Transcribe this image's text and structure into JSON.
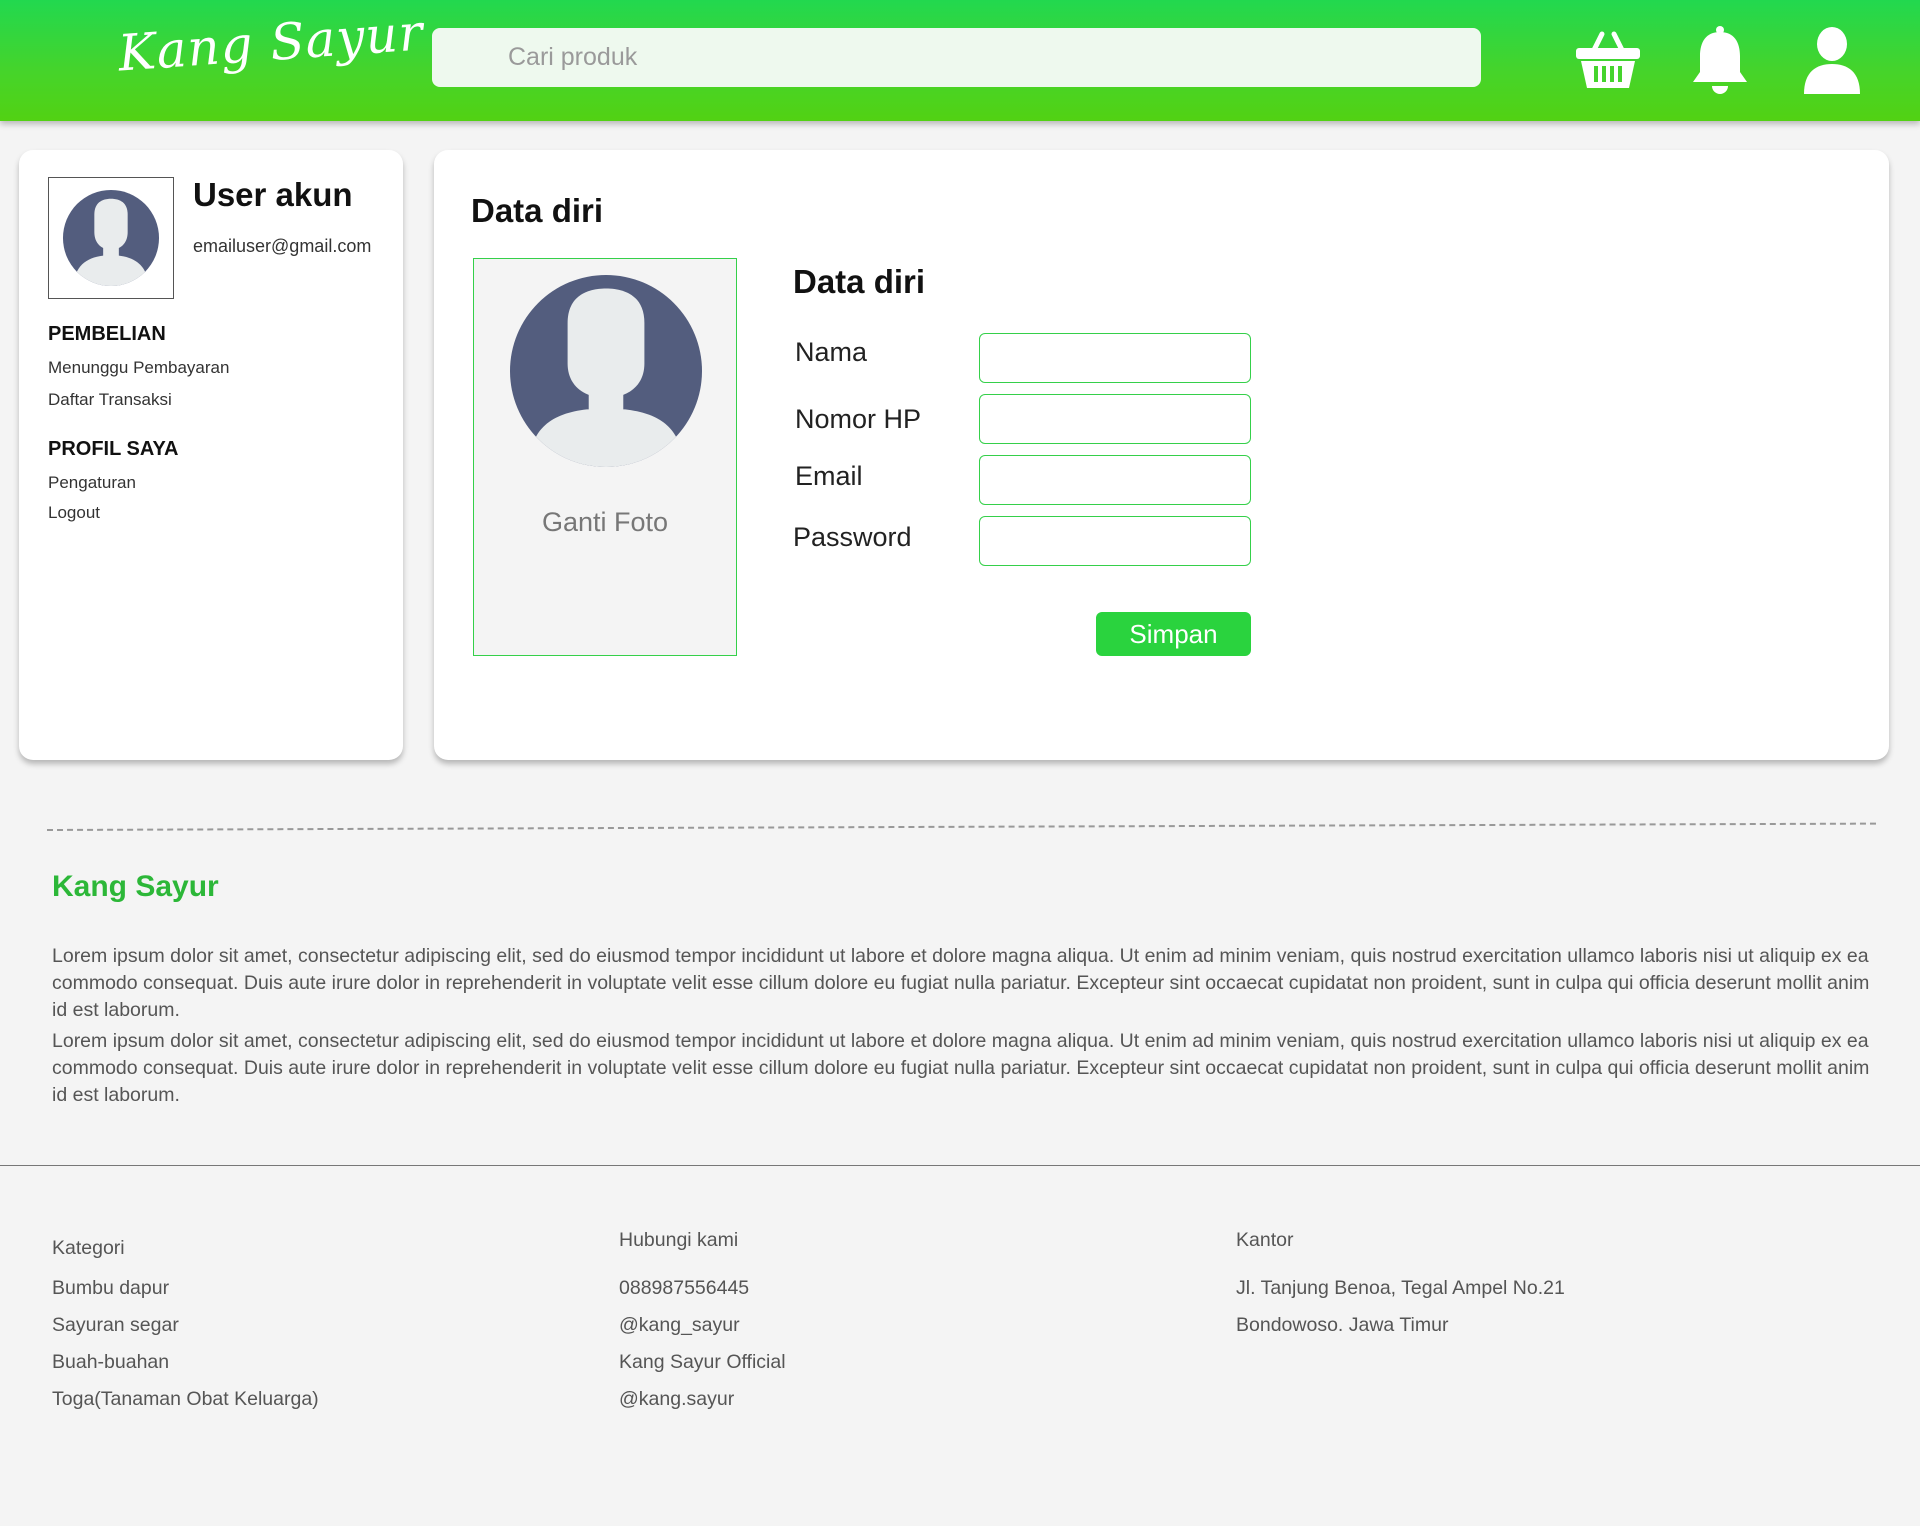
{
  "header": {
    "logo": "Kang Sayur",
    "search_placeholder": "Cari produk",
    "icons": [
      "basket-icon",
      "bell-icon",
      "user-icon"
    ]
  },
  "sidebar": {
    "user_name": "User akun",
    "email": "emailuser@gmail.com",
    "sections": [
      {
        "title": "PEMBELIAN",
        "items": [
          "Menunggu Pembayaran",
          "Daftar Transaksi"
        ]
      },
      {
        "title": "PROFIL SAYA",
        "items": [
          "Pengaturan",
          "Logout"
        ]
      }
    ]
  },
  "main": {
    "title": "Data diri",
    "change_photo": "Ganti Foto",
    "form_title": "Data diri",
    "fields": [
      {
        "label": "Nama",
        "value": ""
      },
      {
        "label": "Nomor HP",
        "value": ""
      },
      {
        "label": "Email",
        "value": ""
      },
      {
        "label": "Password",
        "value": ""
      }
    ],
    "save_label": "Simpan"
  },
  "about": {
    "title": "Kang Sayur",
    "paragraphs": [
      "Lorem ipsum dolor sit amet, consectetur adipiscing elit, sed do eiusmod tempor incididunt ut labore et dolore magna aliqua. Ut enim ad minim veniam, quis nostrud exercitation ullamco laboris nisi ut aliquip ex ea commodo consequat. Duis aute irure dolor in reprehenderit in voluptate velit esse cillum dolore eu fugiat nulla pariatur. Excepteur sint occaecat cupidatat non proident, sunt in culpa qui officia deserunt mollit anim id est laborum.",
      "Lorem ipsum dolor sit amet, consectetur adipiscing elit, sed do eiusmod tempor incididunt ut labore et dolore magna aliqua. Ut enim ad minim veniam, quis nostrud exercitation ullamco laboris nisi ut aliquip ex ea commodo consequat. Duis aute irure dolor in reprehenderit in voluptate velit esse cillum dolore eu fugiat nulla pariatur. Excepteur sint occaecat cupidatat non proident, sunt in culpa qui officia deserunt mollit anim id est laborum."
    ]
  },
  "footer": {
    "kategori": {
      "title": "Kategori",
      "items": [
        "Bumbu dapur",
        "Sayuran segar",
        "Buah-buahan",
        "Toga(Tanaman Obat Keluarga)"
      ]
    },
    "hubungi": {
      "title": "Hubungi kami",
      "items": [
        "088987556445",
        "@kang_sayur",
        "Kang Sayur Official",
        "@kang.sayur"
      ]
    },
    "kantor": {
      "title": "Kantor",
      "items": [
        "Jl. Tanjung Benoa, Tegal Ampel No.21",
        "Bondowoso. Jawa Timur"
      ]
    }
  },
  "colors": {
    "brand_green": "#2ad33e",
    "header_top": "#22d84f",
    "header_bottom": "#52d213",
    "title_green": "#2cb738",
    "avatar_blue": "#535d7e"
  }
}
